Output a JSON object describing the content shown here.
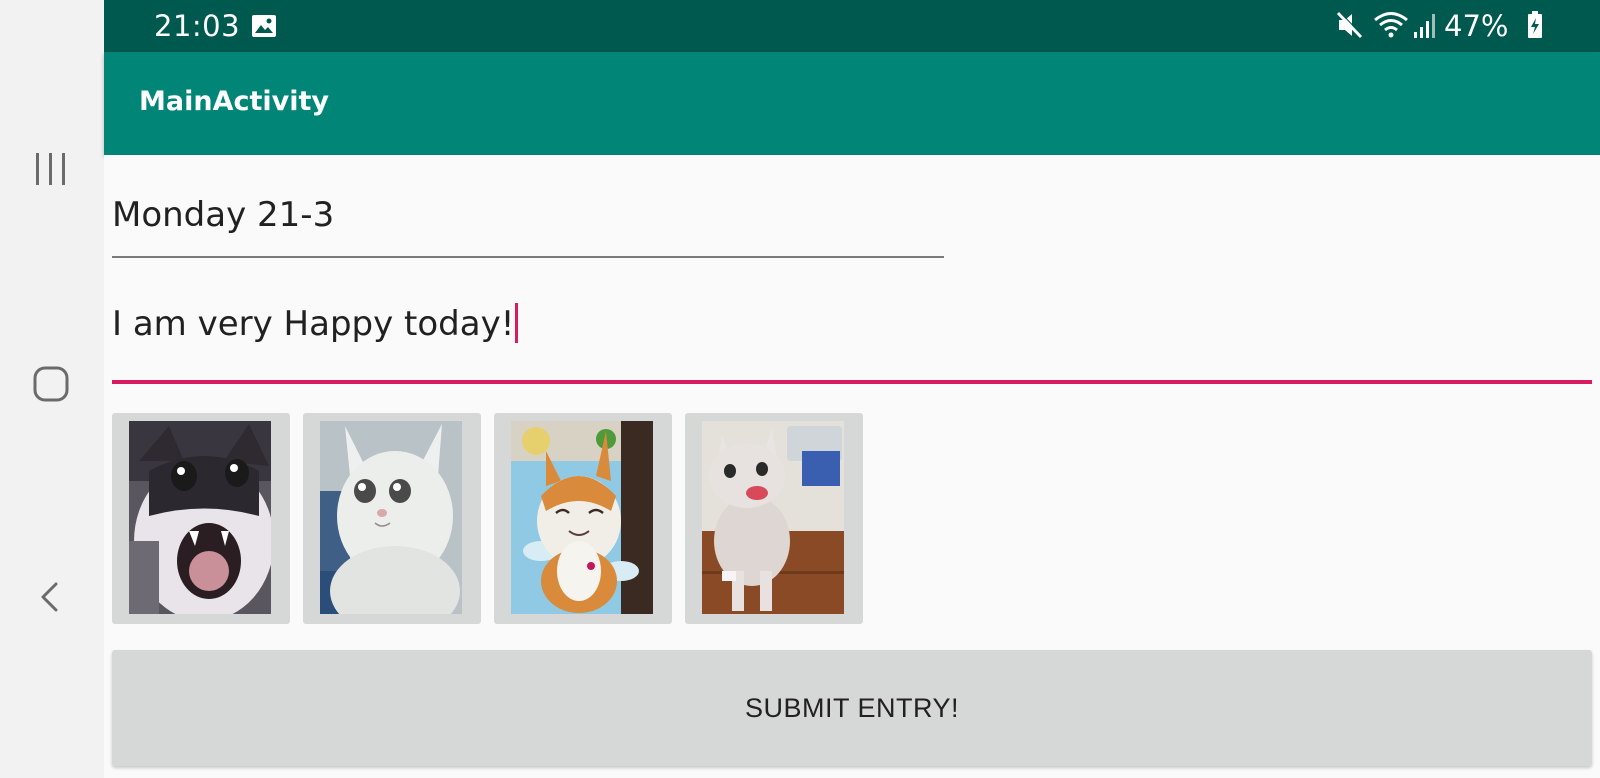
{
  "status_bar": {
    "time": "21:03",
    "battery_percent": "47%",
    "icons": [
      "gallery-notification-icon",
      "mute-icon",
      "wifi-icon",
      "signal-icon",
      "battery-charging-icon"
    ]
  },
  "app_bar": {
    "title": "MainActivity"
  },
  "form": {
    "date_value": "Monday 21-3",
    "entry_value": "I am very Happy today!",
    "mood_images": [
      {
        "name": "screaming-cat-image"
      },
      {
        "name": "crying-cat-image"
      },
      {
        "name": "smiling-cat-image"
      },
      {
        "name": "laughing-cat-image"
      }
    ],
    "submit_label": "SUBMIT ENTRY!"
  },
  "navigation": {
    "buttons": [
      "recents-icon",
      "home-icon",
      "back-icon"
    ]
  },
  "colors": {
    "status_bar": "#00594f",
    "app_bar": "#008577",
    "accent": "#d81b60",
    "button": "#d6d7d7"
  }
}
